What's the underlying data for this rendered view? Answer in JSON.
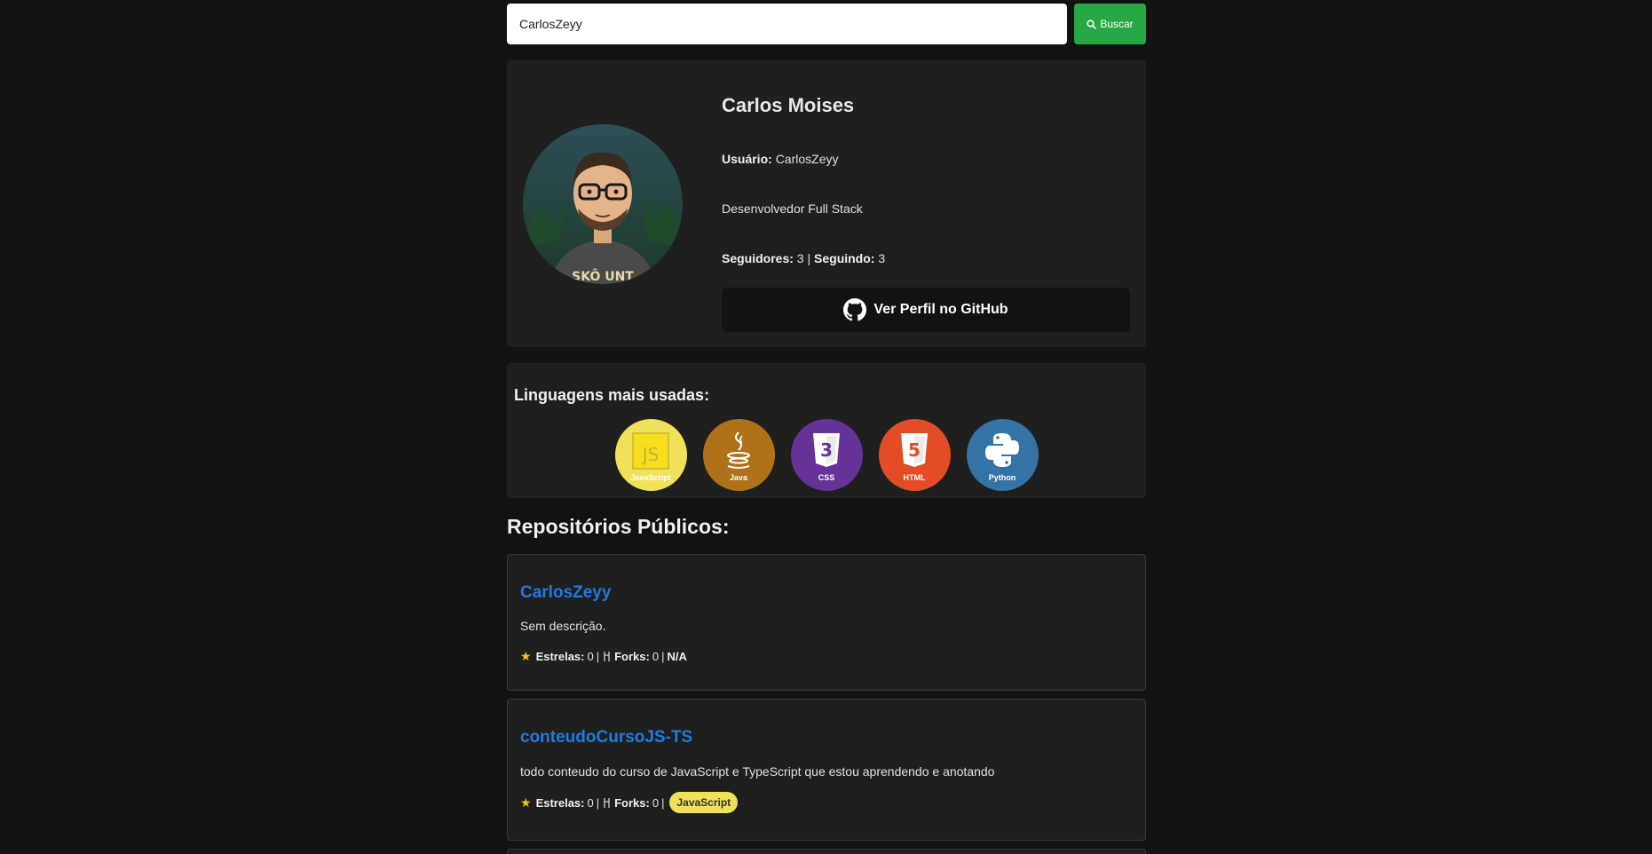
{
  "search": {
    "value": "CarlosZeyy",
    "button_label": "Buscar"
  },
  "profile": {
    "name": "Carlos Moises",
    "username_label": "Usuário:",
    "username": "CarlosZeyy",
    "bio": "Desenvolvedor Full Stack",
    "followers_label": "Seguidores:",
    "followers": "3",
    "following_label": "Seguindo:",
    "following": "3",
    "separator": "|",
    "github_button_label": "Ver Perfil no GitHub",
    "avatar_hoodie_text": "SKÔ UNT"
  },
  "languages": {
    "title": "Linguagens mais usadas:",
    "items": [
      {
        "label": "JavaScript",
        "color": "#f1e05a",
        "icon": "javascript-icon"
      },
      {
        "label": "Java",
        "color": "#b07219",
        "icon": "java-icon"
      },
      {
        "label": "CSS",
        "color": "#663399",
        "icon": "css-icon"
      },
      {
        "label": "HTML",
        "color": "#e34c26",
        "icon": "html-icon"
      },
      {
        "label": "Python",
        "color": "#3572a5",
        "icon": "python-icon"
      }
    ]
  },
  "repos": {
    "title": "Repositórios Públicos:",
    "stars_label": "Estrelas:",
    "forks_label": "Forks:",
    "items": [
      {
        "name": "CarlosZeyy",
        "description": "Sem descrição.",
        "stars": "0",
        "forks": "0",
        "language": "N/A"
      },
      {
        "name": "conteudoCursoJS-TS",
        "description": "todo conteudo do curso de JavaScript e TypeScript que estou aprendendo e anotando",
        "stars": "0",
        "forks": "0",
        "language": "JavaScript"
      }
    ]
  }
}
